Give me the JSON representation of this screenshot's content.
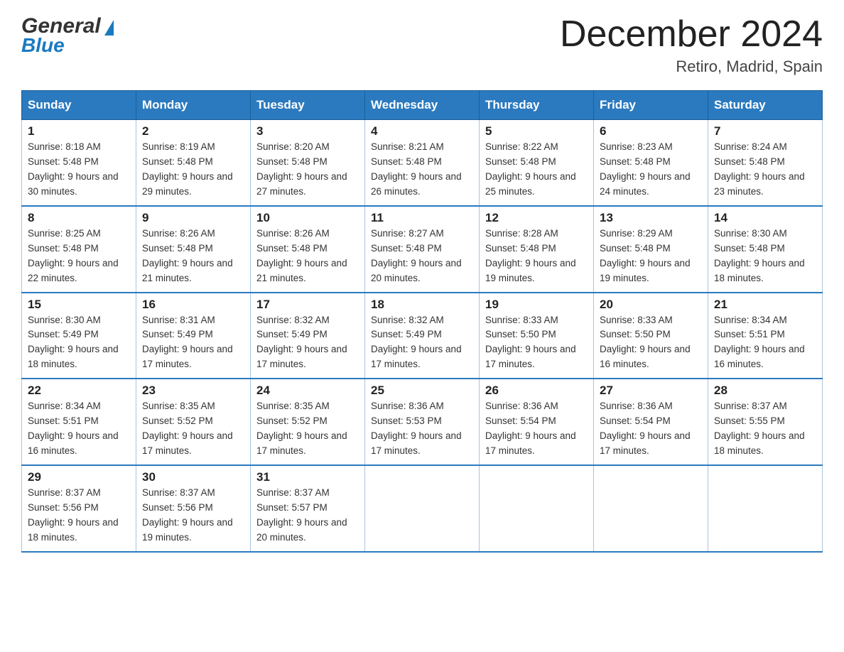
{
  "logo": {
    "general": "General",
    "blue": "Blue"
  },
  "header": {
    "month": "December 2024",
    "location": "Retiro, Madrid, Spain"
  },
  "days_of_week": [
    "Sunday",
    "Monday",
    "Tuesday",
    "Wednesday",
    "Thursday",
    "Friday",
    "Saturday"
  ],
  "weeks": [
    [
      {
        "day": "1",
        "sunrise": "Sunrise: 8:18 AM",
        "sunset": "Sunset: 5:48 PM",
        "daylight": "Daylight: 9 hours and 30 minutes."
      },
      {
        "day": "2",
        "sunrise": "Sunrise: 8:19 AM",
        "sunset": "Sunset: 5:48 PM",
        "daylight": "Daylight: 9 hours and 29 minutes."
      },
      {
        "day": "3",
        "sunrise": "Sunrise: 8:20 AM",
        "sunset": "Sunset: 5:48 PM",
        "daylight": "Daylight: 9 hours and 27 minutes."
      },
      {
        "day": "4",
        "sunrise": "Sunrise: 8:21 AM",
        "sunset": "Sunset: 5:48 PM",
        "daylight": "Daylight: 9 hours and 26 minutes."
      },
      {
        "day": "5",
        "sunrise": "Sunrise: 8:22 AM",
        "sunset": "Sunset: 5:48 PM",
        "daylight": "Daylight: 9 hours and 25 minutes."
      },
      {
        "day": "6",
        "sunrise": "Sunrise: 8:23 AM",
        "sunset": "Sunset: 5:48 PM",
        "daylight": "Daylight: 9 hours and 24 minutes."
      },
      {
        "day": "7",
        "sunrise": "Sunrise: 8:24 AM",
        "sunset": "Sunset: 5:48 PM",
        "daylight": "Daylight: 9 hours and 23 minutes."
      }
    ],
    [
      {
        "day": "8",
        "sunrise": "Sunrise: 8:25 AM",
        "sunset": "Sunset: 5:48 PM",
        "daylight": "Daylight: 9 hours and 22 minutes."
      },
      {
        "day": "9",
        "sunrise": "Sunrise: 8:26 AM",
        "sunset": "Sunset: 5:48 PM",
        "daylight": "Daylight: 9 hours and 21 minutes."
      },
      {
        "day": "10",
        "sunrise": "Sunrise: 8:26 AM",
        "sunset": "Sunset: 5:48 PM",
        "daylight": "Daylight: 9 hours and 21 minutes."
      },
      {
        "day": "11",
        "sunrise": "Sunrise: 8:27 AM",
        "sunset": "Sunset: 5:48 PM",
        "daylight": "Daylight: 9 hours and 20 minutes."
      },
      {
        "day": "12",
        "sunrise": "Sunrise: 8:28 AM",
        "sunset": "Sunset: 5:48 PM",
        "daylight": "Daylight: 9 hours and 19 minutes."
      },
      {
        "day": "13",
        "sunrise": "Sunrise: 8:29 AM",
        "sunset": "Sunset: 5:48 PM",
        "daylight": "Daylight: 9 hours and 19 minutes."
      },
      {
        "day": "14",
        "sunrise": "Sunrise: 8:30 AM",
        "sunset": "Sunset: 5:48 PM",
        "daylight": "Daylight: 9 hours and 18 minutes."
      }
    ],
    [
      {
        "day": "15",
        "sunrise": "Sunrise: 8:30 AM",
        "sunset": "Sunset: 5:49 PM",
        "daylight": "Daylight: 9 hours and 18 minutes."
      },
      {
        "day": "16",
        "sunrise": "Sunrise: 8:31 AM",
        "sunset": "Sunset: 5:49 PM",
        "daylight": "Daylight: 9 hours and 17 minutes."
      },
      {
        "day": "17",
        "sunrise": "Sunrise: 8:32 AM",
        "sunset": "Sunset: 5:49 PM",
        "daylight": "Daylight: 9 hours and 17 minutes."
      },
      {
        "day": "18",
        "sunrise": "Sunrise: 8:32 AM",
        "sunset": "Sunset: 5:49 PM",
        "daylight": "Daylight: 9 hours and 17 minutes."
      },
      {
        "day": "19",
        "sunrise": "Sunrise: 8:33 AM",
        "sunset": "Sunset: 5:50 PM",
        "daylight": "Daylight: 9 hours and 17 minutes."
      },
      {
        "day": "20",
        "sunrise": "Sunrise: 8:33 AM",
        "sunset": "Sunset: 5:50 PM",
        "daylight": "Daylight: 9 hours and 16 minutes."
      },
      {
        "day": "21",
        "sunrise": "Sunrise: 8:34 AM",
        "sunset": "Sunset: 5:51 PM",
        "daylight": "Daylight: 9 hours and 16 minutes."
      }
    ],
    [
      {
        "day": "22",
        "sunrise": "Sunrise: 8:34 AM",
        "sunset": "Sunset: 5:51 PM",
        "daylight": "Daylight: 9 hours and 16 minutes."
      },
      {
        "day": "23",
        "sunrise": "Sunrise: 8:35 AM",
        "sunset": "Sunset: 5:52 PM",
        "daylight": "Daylight: 9 hours and 17 minutes."
      },
      {
        "day": "24",
        "sunrise": "Sunrise: 8:35 AM",
        "sunset": "Sunset: 5:52 PM",
        "daylight": "Daylight: 9 hours and 17 minutes."
      },
      {
        "day": "25",
        "sunrise": "Sunrise: 8:36 AM",
        "sunset": "Sunset: 5:53 PM",
        "daylight": "Daylight: 9 hours and 17 minutes."
      },
      {
        "day": "26",
        "sunrise": "Sunrise: 8:36 AM",
        "sunset": "Sunset: 5:54 PM",
        "daylight": "Daylight: 9 hours and 17 minutes."
      },
      {
        "day": "27",
        "sunrise": "Sunrise: 8:36 AM",
        "sunset": "Sunset: 5:54 PM",
        "daylight": "Daylight: 9 hours and 17 minutes."
      },
      {
        "day": "28",
        "sunrise": "Sunrise: 8:37 AM",
        "sunset": "Sunset: 5:55 PM",
        "daylight": "Daylight: 9 hours and 18 minutes."
      }
    ],
    [
      {
        "day": "29",
        "sunrise": "Sunrise: 8:37 AM",
        "sunset": "Sunset: 5:56 PM",
        "daylight": "Daylight: 9 hours and 18 minutes."
      },
      {
        "day": "30",
        "sunrise": "Sunrise: 8:37 AM",
        "sunset": "Sunset: 5:56 PM",
        "daylight": "Daylight: 9 hours and 19 minutes."
      },
      {
        "day": "31",
        "sunrise": "Sunrise: 8:37 AM",
        "sunset": "Sunset: 5:57 PM",
        "daylight": "Daylight: 9 hours and 20 minutes."
      },
      null,
      null,
      null,
      null
    ]
  ]
}
